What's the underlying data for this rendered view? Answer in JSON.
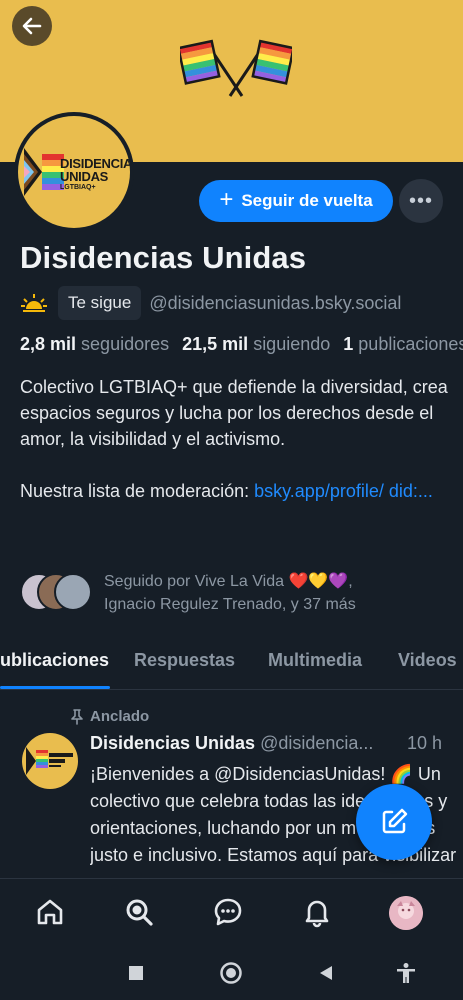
{
  "profile": {
    "display_name": "Disidencias Unidas",
    "follows_you_label": "Te sigue",
    "handle": "@disidenciasunidas.bsky.social",
    "avatar_title": "DISIDENCIAS\nUNIDAS",
    "avatar_subtitle": "LGTBIAQ+",
    "banner_color": "#e9bd4e"
  },
  "actions": {
    "follow_back_label": "Seguir de vuelta",
    "more_label": "•••"
  },
  "stats": {
    "followers_count": "2,8 mil",
    "followers_label": "seguidores",
    "following_count": "21,5 mil",
    "following_label": "siguiendo",
    "posts_count": "1",
    "posts_label": "publicaciones"
  },
  "bio": {
    "text": "Colectivo LGTBIAQ+ que defiende la diversidad, crea espacios seguros y lucha por los derechos desde el amor, la visibilidad y el activismo.",
    "moderation_prefix": "Nuestra lista de moderación: ",
    "moderation_link": "bsky.app/profile/ did:..."
  },
  "followed_by": {
    "line1": "Seguido por Vive La Vida ",
    "hearts": "❤️💛💜,",
    "line2": "Ignacio Regulez Trenado, y 37 más"
  },
  "tabs": [
    {
      "label": "Publicaciones"
    },
    {
      "label": "Respuestas"
    },
    {
      "label": "Multimedia"
    },
    {
      "label": "Videos"
    }
  ],
  "post": {
    "pinned_label": "Anclado",
    "author_name": "Disidencias Unidas",
    "author_handle": "@disidencia...",
    "time": "10 h",
    "body": "¡Bienvenides a @DisidenciasUnidas! 🌈 Un colectivo que celebra todas las identidades y orientaciones, luchando por un mundo más justo e inclusivo. Estamos aquí para visibilizar"
  },
  "nav": {
    "items": [
      "home-icon",
      "search-icon",
      "chat-icon",
      "bell-icon",
      "profile-avatar"
    ]
  },
  "colors": {
    "accent": "#1083fe",
    "background": "#161e27",
    "muted_text": "#8c97a3"
  }
}
